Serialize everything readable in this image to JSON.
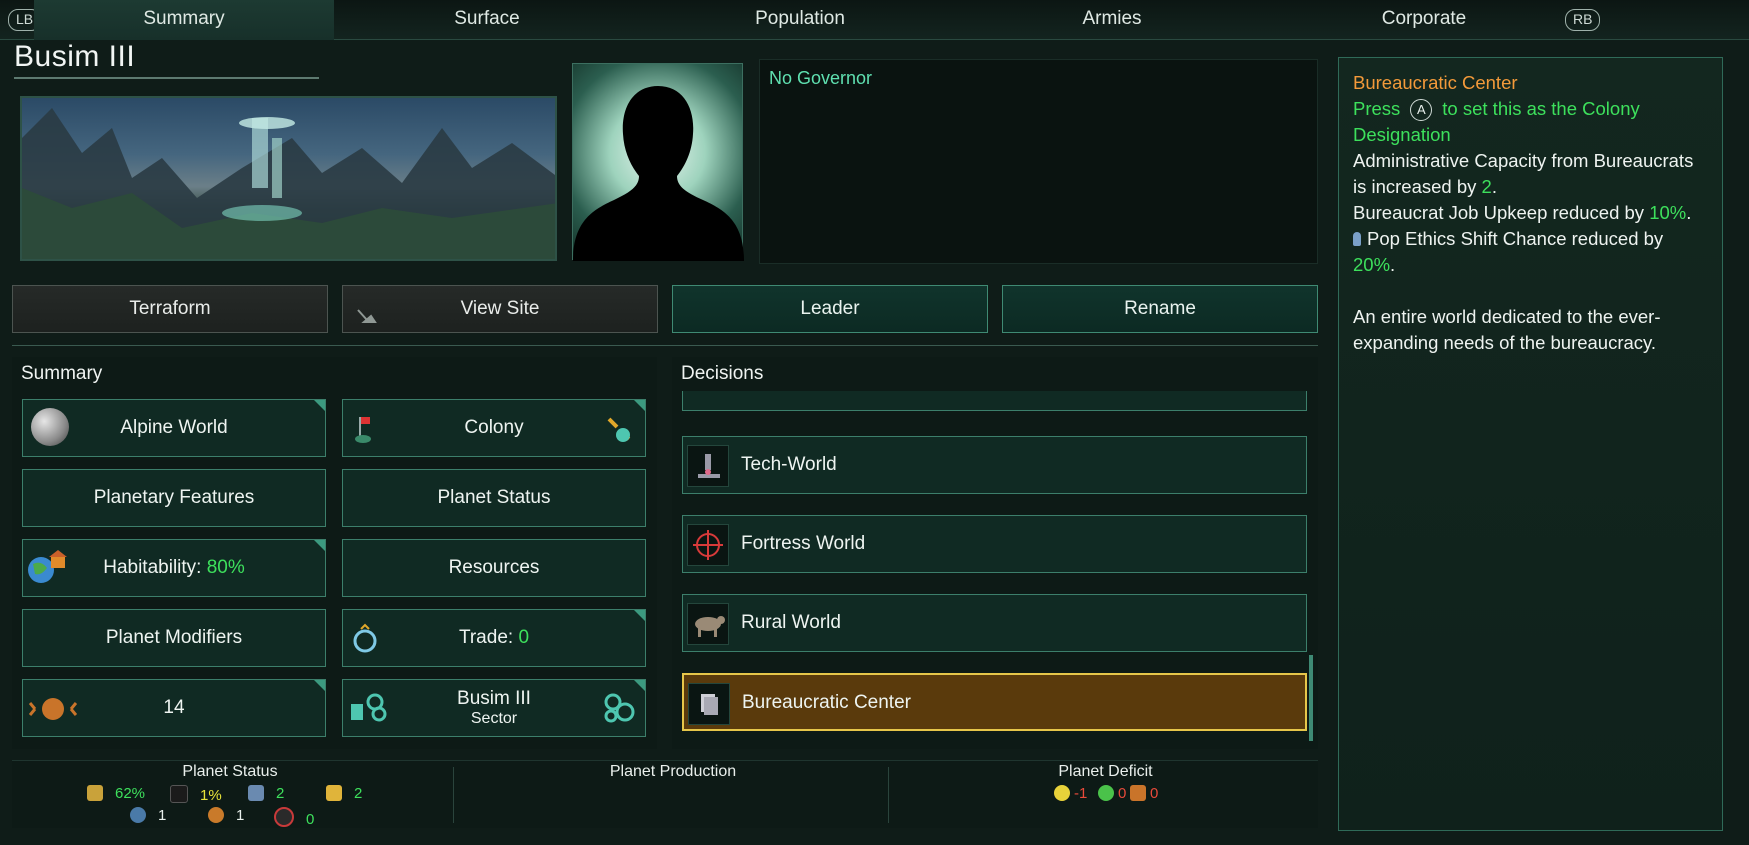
{
  "tabs": {
    "lb": "LB",
    "rb": "RB",
    "items": [
      "Summary",
      "Surface",
      "Population",
      "Armies",
      "Corporate"
    ]
  },
  "planet": {
    "name": "Busim III"
  },
  "governor": {
    "label": "No Governor"
  },
  "actions": {
    "terraform": "Terraform",
    "view_site": "View Site",
    "leader": "Leader",
    "rename": "Rename"
  },
  "summary": {
    "title": "Summary",
    "planet_class": "Alpine World",
    "colony": "Colony",
    "planetary_features": "Planetary Features",
    "planet_status": "Planet Status",
    "habitability_label": "Habitability:",
    "habitability_value": "80%",
    "resources": "Resources",
    "planet_modifiers": "Planet Modifiers",
    "trade_label": "Trade:",
    "trade_value": "0",
    "size": "14",
    "sector_name": "Busim III",
    "sector_label": "Sector"
  },
  "decisions": {
    "title": "Decisions",
    "items": [
      "Tech-World",
      "Fortress World",
      "Rural World",
      "Bureaucratic Center"
    ],
    "selected": "Bureaucratic Center"
  },
  "bottom": {
    "status_title": "Planet Status",
    "production_title": "Planet Production",
    "deficit_title": "Planet Deficit",
    "status_values": [
      "62%",
      "1%",
      "2",
      "2",
      "1",
      "1",
      "0"
    ],
    "deficit_values": [
      "-1",
      "0",
      "0"
    ]
  },
  "tooltip": {
    "title": "Bureaucratic Center",
    "press": "Press",
    "press_button": "A",
    "press_rest": "to set this as the Colony Designation",
    "line1a": "Administrative Capacity from Bureaucrats is increased by ",
    "line1b": "2",
    "line2a": "Bureaucrat Job Upkeep reduced by ",
    "line2b": "10%",
    "line3a": "Pop Ethics Shift Chance reduced by ",
    "line3b": "20%",
    "description": "An entire world dedicated to the ever-expanding needs of the bureaucracy."
  },
  "colors": {
    "accent_teal": "#3c7f6b",
    "positive": "#3de05c",
    "warning": "#e8e43a",
    "title_orange": "#f39a3a",
    "negative": "#e84a3a",
    "selected_fill": "#5a3a0c",
    "selected_border": "#e6c64a"
  },
  "icons": {
    "planet": "alpine-planet-icon",
    "colony": "colony-flag-icon",
    "habitability": "habitability-globe-icon",
    "trade": "trade-icon",
    "size": "planet-size-icon",
    "sector": "sector-icon",
    "tech": "microscope-icon",
    "fortress": "crosshair-icon",
    "rural": "cattle-icon",
    "bureaucratic": "paper-stack-icon"
  }
}
